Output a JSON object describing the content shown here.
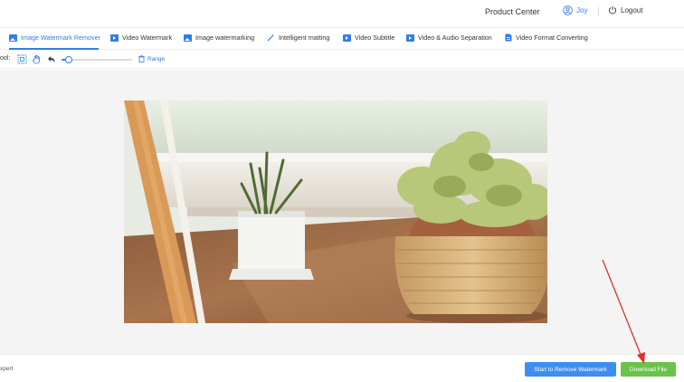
{
  "header": {
    "product_center": "Product Center",
    "user_name": "Joy",
    "logout": "Logout"
  },
  "tabs": [
    {
      "label": "Image Watermark Remover",
      "icon": "image-icon",
      "active": true
    },
    {
      "label": "Video Watermark",
      "icon": "video-icon"
    },
    {
      "label": "Image watermarking",
      "icon": "image-icon"
    },
    {
      "label": "Intelligent matting",
      "icon": "magic-wand-icon"
    },
    {
      "label": "Video Subtitle",
      "icon": "video-icon"
    },
    {
      "label": "Video & Audio Separation",
      "icon": "video-icon"
    },
    {
      "label": "Video Format Converting",
      "icon": "document-icon"
    }
  ],
  "toolbar": {
    "label": "ool:",
    "range_label": "Range",
    "brush_size": 0.1
  },
  "footer": {
    "mode_label": "xpert",
    "remove_button": "Start to Remove Watermark",
    "download_button": "Download File"
  },
  "colors": {
    "accent_blue": "#2f7fe0",
    "remove_button": "#3d8ef0",
    "download_button": "#6cc24a",
    "annotation_arrow": "#e0302a"
  }
}
